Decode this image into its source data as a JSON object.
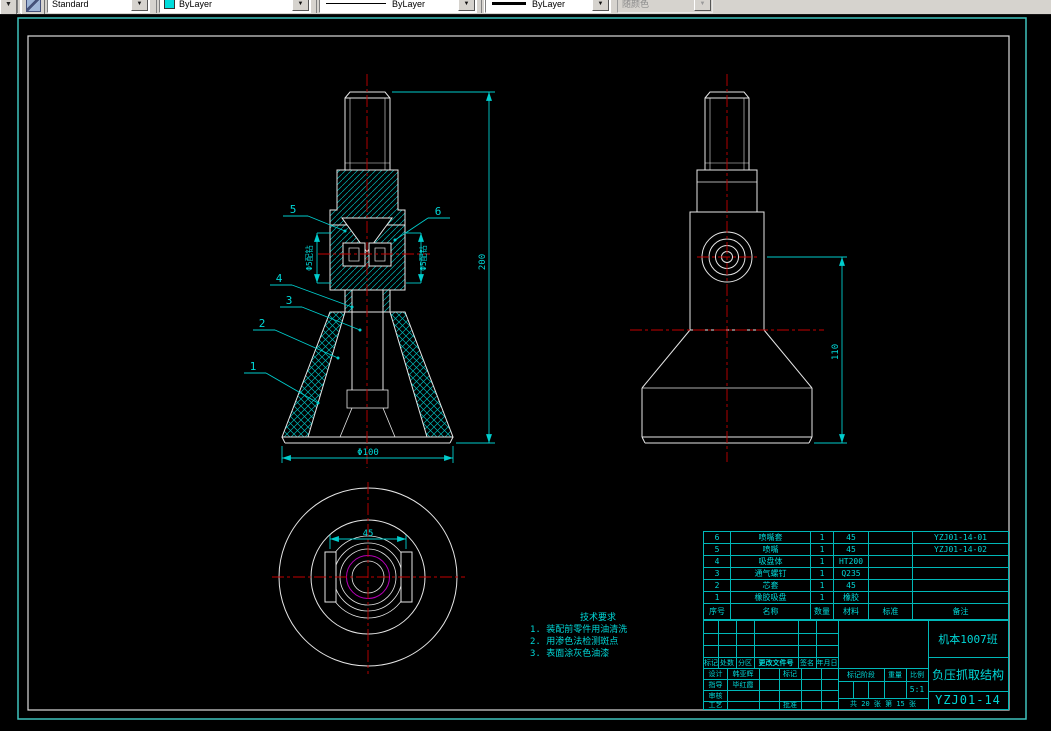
{
  "toolbar": {
    "style_combo": "Standard",
    "color_combo": "ByLayer",
    "linetype_combo": "ByLayer",
    "lineweight_combo": "ByLayer",
    "plotstyle_combo": "随颜色"
  },
  "colors": {
    "dimension_cyan": "#00d8d8",
    "centerline_red": "#c40000",
    "outline_white": "#e6e6e6",
    "rubber_magenta": "#b800b8",
    "paper_border_teal": "#3fc3bd",
    "toolbar_gray": "#d6d3ce",
    "color_swatch_cyan": "#00dcdc"
  },
  "views": {
    "dims": {
      "front_height": "200",
      "front_diameter": "Φ100",
      "nozzle_hole_left": "Φ5配钻",
      "nozzle_hole_right": "Φ5配钻",
      "side_height": "110",
      "bottom_width": "45"
    },
    "callouts": [
      "1",
      "2",
      "3",
      "4",
      "5",
      "6"
    ]
  },
  "technotes": {
    "title": "技术要求",
    "lines": [
      "1. 装配前零件用油清洗",
      "2. 用渗色法检测斑点",
      "3. 表面涂灰色油漆"
    ]
  },
  "bom": {
    "headers": {
      "no": "序号",
      "name": "名称",
      "qty": "数量",
      "material": "材料",
      "standard": "标准",
      "remark": "备注"
    },
    "rows": [
      {
        "no": "6",
        "name": "喷嘴套",
        "qty": "1",
        "material": "45",
        "standard": "",
        "remark": "YZJ01-14-01"
      },
      {
        "no": "5",
        "name": "喷嘴",
        "qty": "1",
        "material": "45",
        "standard": "",
        "remark": "YZJ01-14-02"
      },
      {
        "no": "4",
        "name": "吸盘体",
        "qty": "1",
        "material": "HT200",
        "standard": "",
        "remark": ""
      },
      {
        "no": "3",
        "name": "通气螺钉",
        "qty": "1",
        "material": "Q235",
        "standard": "",
        "remark": ""
      },
      {
        "no": "2",
        "name": "芯套",
        "qty": "1",
        "material": "45",
        "standard": "",
        "remark": ""
      },
      {
        "no": "1",
        "name": "橡胶吸盘",
        "qty": "1",
        "material": "橡胶",
        "standard": "",
        "remark": ""
      }
    ]
  },
  "titleblock": {
    "revision_headers": [
      "标记",
      "处数",
      "分区",
      "更改文件号",
      "签名",
      "年月日"
    ],
    "design_label": "设计",
    "design_name": "韩亚辉",
    "mark_label": "标记",
    "advisor_label": "指导",
    "advisor_name": "毕红霞",
    "check_label": "审核",
    "process_label": "工艺",
    "approve_label": "批准",
    "stage_label": "标记阶段",
    "weight_label": "重量",
    "scale_label": "比例",
    "scale_value": "5:1",
    "sheet_info": "共 20 张 第 15 张",
    "org_class": "机本1007班",
    "drawing_title": "负压抓取结构",
    "drawing_number": "YZJ01-14"
  }
}
